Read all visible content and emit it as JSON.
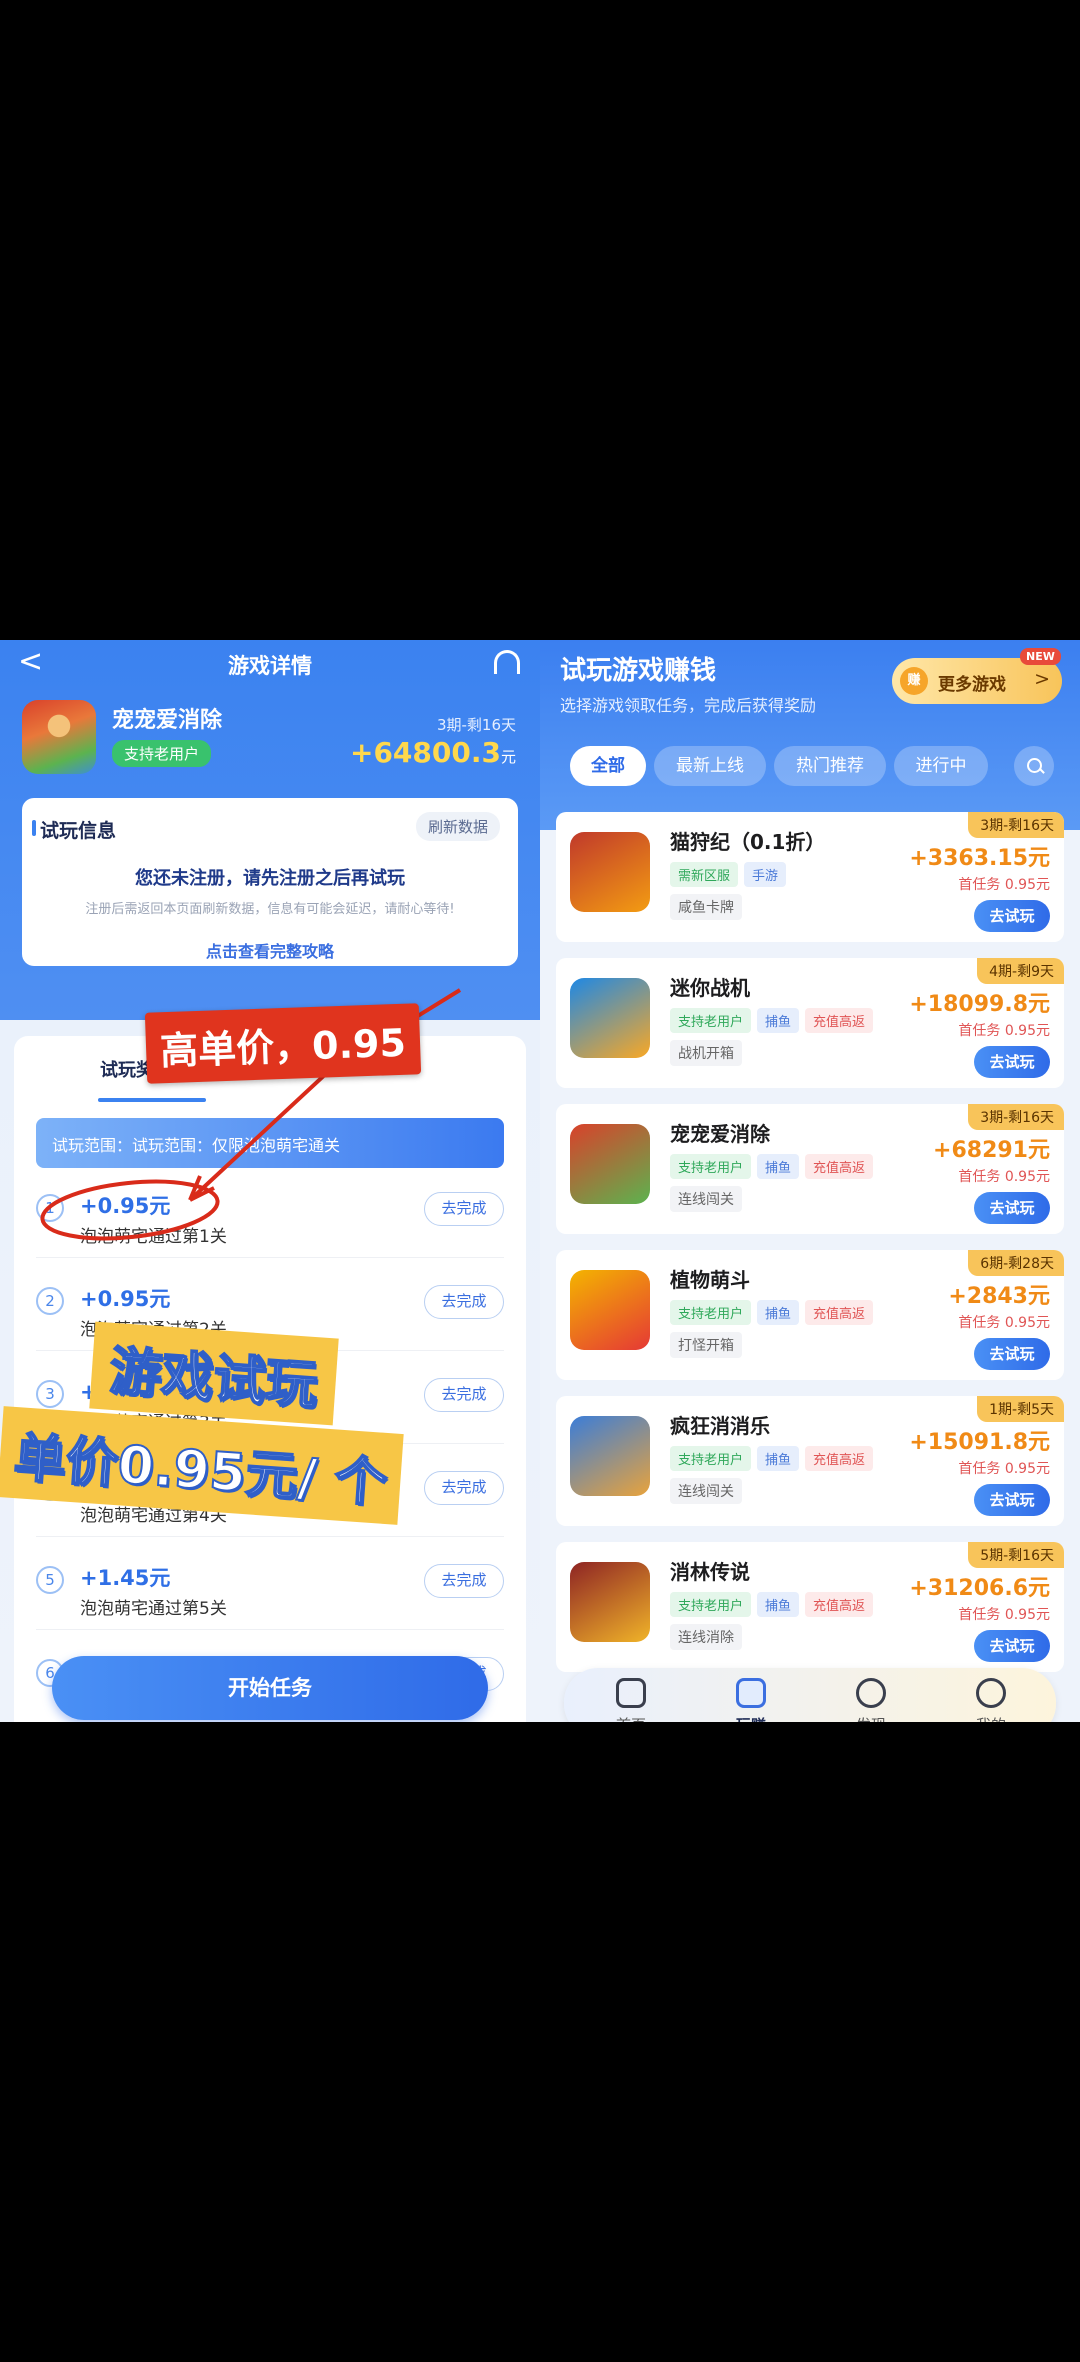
{
  "left": {
    "header_title": "游戏详情",
    "game_name": "宠宠爱消除",
    "badge": "支持老用户",
    "period": "3期-剩16天",
    "reward": "+64800.3",
    "reward_unit": "元",
    "info": {
      "title": "试玩信息",
      "refresh": "刷新数据",
      "main": "您还未注册，请先注册之后再试玩",
      "sub": "注册后需返回本页面刷新数据，信息有可能会延迟，请耐心等待!",
      "link": "点击查看完整攻略"
    },
    "tab_reward": "试玩奖励",
    "scope": "试玩范围：试玩范围：仅限泡泡萌宅通关",
    "tasks": [
      {
        "num": "1",
        "amount": "+0.95元",
        "desc": "泡泡萌宅通过第1关",
        "btn": "去完成"
      },
      {
        "num": "2",
        "amount": "+0.95元",
        "desc": "泡泡萌宅通过第2关",
        "btn": "去完成"
      },
      {
        "num": "3",
        "amount": "+0.95元",
        "desc": "泡泡萌宅通过第3关",
        "btn": "去完成"
      },
      {
        "num": "4",
        "amount": "+0.95元",
        "desc": "泡泡萌宅通过第4关",
        "btn": "去完成"
      },
      {
        "num": "5",
        "amount": "+1.45元",
        "desc": "泡泡萌宅通过第5关",
        "btn": "去完成"
      },
      {
        "num": "6",
        "amount": "",
        "desc": "",
        "btn": "去完成"
      }
    ],
    "start_button": "开始任务"
  },
  "overlay": {
    "price_label": "高单价，0.95",
    "line1": "游戏试玩",
    "line2": "单价0.95元/ 个"
  },
  "right": {
    "title": "试玩游戏赚钱",
    "subtitle": "选择游戏领取任务，完成后获得奖励",
    "more_coin": "赚",
    "more_label": "更多游戏",
    "new_badge": "NEW",
    "filters": [
      "全部",
      "最新上线",
      "热门推荐",
      "进行中"
    ],
    "games": [
      {
        "name": "猫狩纪（0.1折）",
        "tags": [
          [
            "需新区服",
            "green"
          ],
          [
            "手游",
            "blue"
          ]
        ],
        "sub": "咸鱼卡牌",
        "period": "3期-剩16天",
        "reward": "+3363.15元",
        "first": "首任务 0.95元",
        "btn": "去试玩",
        "icon_colors": [
          "#c0392b",
          "#f39c12"
        ]
      },
      {
        "name": "迷你战机",
        "tags": [
          [
            "支持老用户",
            "green"
          ],
          [
            "捕鱼",
            "blue"
          ],
          [
            "充值高返",
            "pink"
          ]
        ],
        "sub": "战机开箱",
        "period": "4期-剩9天",
        "reward": "+18099.8元",
        "first": "首任务 0.95元",
        "btn": "去试玩",
        "icon_colors": [
          "#1e88e5",
          "#f9a825"
        ]
      },
      {
        "name": "宠宠爱消除",
        "tags": [
          [
            "支持老用户",
            "green"
          ],
          [
            "捕鱼",
            "blue"
          ],
          [
            "充值高返",
            "pink"
          ]
        ],
        "sub": "连线闯关",
        "period": "3期-剩16天",
        "reward": "+68291元",
        "first": "首任务 0.95元",
        "btn": "去试玩",
        "icon_colors": [
          "#d9412b",
          "#5cb34f"
        ]
      },
      {
        "name": "植物萌斗",
        "tags": [
          [
            "支持老用户",
            "green"
          ],
          [
            "捕鱼",
            "blue"
          ],
          [
            "充值高返",
            "pink"
          ]
        ],
        "sub": "打怪开箱",
        "period": "6期-剩28天",
        "reward": "+2843元",
        "first": "首任务 0.95元",
        "btn": "去试玩",
        "icon_colors": [
          "#f4b400",
          "#e53935"
        ]
      },
      {
        "name": "疯狂消消乐",
        "tags": [
          [
            "支持老用户",
            "green"
          ],
          [
            "捕鱼",
            "blue"
          ],
          [
            "充值高返",
            "pink"
          ]
        ],
        "sub": "连线闯关",
        "period": "1期-剩5天",
        "reward": "+15091.8元",
        "first": "首任务 0.95元",
        "btn": "去试玩",
        "icon_colors": [
          "#3b7dd8",
          "#e8a33c"
        ]
      },
      {
        "name": "消林传说",
        "tags": [
          [
            "支持老用户",
            "green"
          ],
          [
            "捕鱼",
            "blue"
          ],
          [
            "充值高返",
            "pink"
          ]
        ],
        "sub": "连线消除",
        "period": "5期-剩16天",
        "reward": "+31206.6元",
        "first": "首任务 0.95元",
        "btn": "去试玩",
        "icon_colors": [
          "#8e2424",
          "#f0b429"
        ]
      }
    ],
    "nav": [
      "首页",
      "玩赚",
      "发现",
      "我的"
    ],
    "nav_active": 1
  },
  "colors": {
    "accent": "#3b82f0",
    "reward": "#f08a16",
    "highlight": "#e0341e"
  }
}
